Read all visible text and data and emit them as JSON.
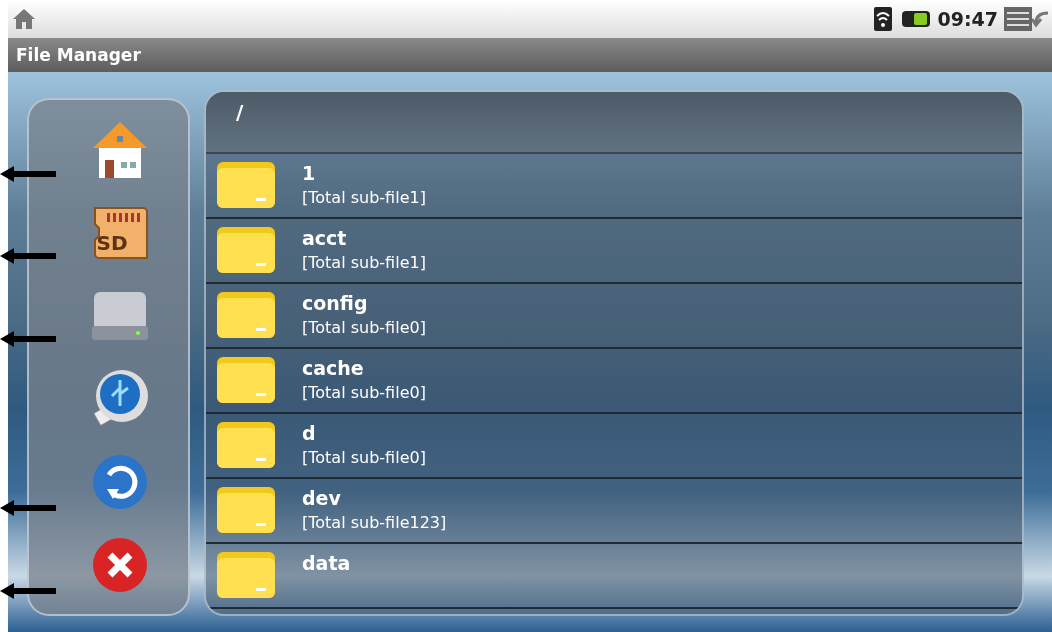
{
  "status_bar": {
    "time": "09:47"
  },
  "window": {
    "title": "File Manager"
  },
  "sidebar": {
    "items": [
      {
        "kind": "home"
      },
      {
        "kind": "sd",
        "label": "SD"
      },
      {
        "kind": "drive"
      },
      {
        "kind": "usb"
      },
      {
        "kind": "refresh"
      },
      {
        "kind": "close"
      }
    ]
  },
  "path": "/",
  "files": [
    {
      "name": "1",
      "info": "[Total sub-file1]"
    },
    {
      "name": "acct",
      "info": "[Total sub-file1]"
    },
    {
      "name": "config",
      "info": "[Total sub-file0]"
    },
    {
      "name": "cache",
      "info": "[Total sub-file0]"
    },
    {
      "name": "d",
      "info": "[Total sub-file0]"
    },
    {
      "name": "dev",
      "info": "[Total sub-file123]"
    },
    {
      "name": "data"
    }
  ]
}
